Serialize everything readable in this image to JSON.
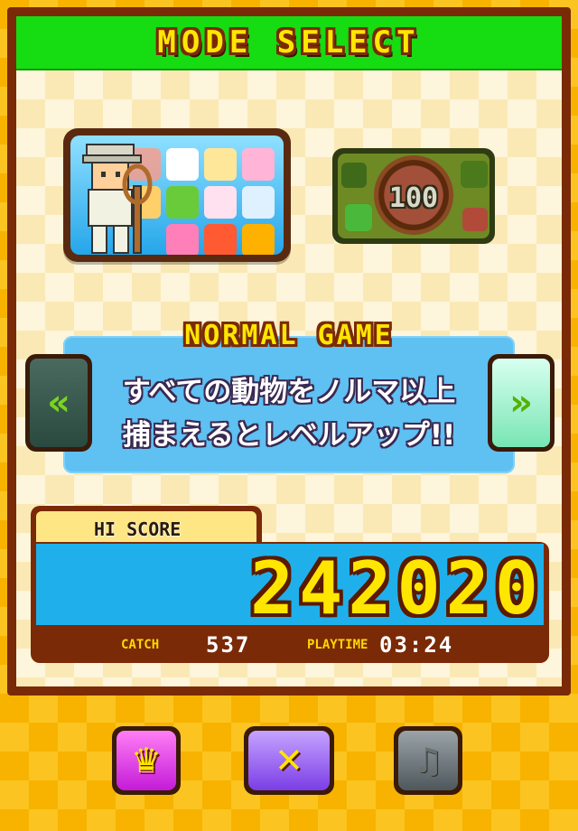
{
  "header": {
    "title": "MODE SELECT"
  },
  "modes": {
    "normal": {
      "icon": "normal-mode-card"
    },
    "hundred": {
      "label": "100"
    }
  },
  "current_mode": {
    "title": "NORMAL GAME",
    "description_line1": "すべての動物をノルマ以上",
    "description_line2": "捕まえるとレベルアップ!!"
  },
  "navigation": {
    "prev_glyph": "«",
    "next_glyph": "»"
  },
  "score": {
    "hi_score_label": "HI SCORE",
    "hi_score_value": "242020",
    "catch_label": "CATCH",
    "catch_value": "537",
    "playtime_label": "PLAYTIME",
    "playtime_value": "03:24"
  },
  "buttons": {
    "ranking_icon": "crown-icon",
    "close_icon": "close-icon",
    "music_icon": "music-note-icon",
    "ranking_glyph": "♛",
    "close_glyph": "✕",
    "music_glyph": "♫"
  },
  "colors": {
    "header_green": "#16dc12",
    "title_yellow": "#ffe600",
    "score_blue": "#1fb0ec",
    "frame_brown": "#7a2a06"
  }
}
